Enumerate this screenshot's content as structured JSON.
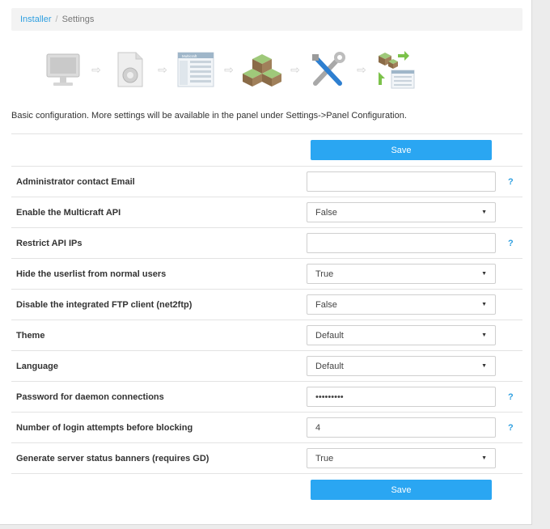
{
  "breadcrumb": {
    "root": "Installer",
    "separator": "/",
    "current": "Settings"
  },
  "steps": [
    {
      "icon": "monitor-icon"
    },
    {
      "icon": "document-gear-icon"
    },
    {
      "icon": "panel-screenshot-icon",
      "caption": "Multicraft"
    },
    {
      "icon": "blocks-icon"
    },
    {
      "icon": "tools-icon"
    },
    {
      "icon": "blocks-panel-icon"
    }
  ],
  "intro": "Basic configuration. More settings will be available in the panel under Settings->Panel Configuration.",
  "buttons": {
    "save": "Save"
  },
  "help_mark": "?",
  "colors": {
    "accent": "#2aa6f2",
    "link": "#2e9fe0"
  },
  "fields": [
    {
      "label": "Administrator contact Email",
      "type": "text",
      "value": "",
      "help": true
    },
    {
      "label": "Enable the Multicraft API",
      "type": "select",
      "value": "False",
      "help": false
    },
    {
      "label": "Restrict API IPs",
      "type": "text",
      "value": "",
      "help": true
    },
    {
      "label": "Hide the userlist from normal users",
      "type": "select",
      "value": "True",
      "help": false
    },
    {
      "label": "Disable the integrated FTP client (net2ftp)",
      "type": "select",
      "value": "False",
      "help": false
    },
    {
      "label": "Theme",
      "type": "select",
      "value": "Default",
      "help": false
    },
    {
      "label": "Language",
      "type": "select",
      "value": "Default",
      "help": false
    },
    {
      "label": "Password for daemon connections",
      "type": "password",
      "value": "•••••••••",
      "help": true
    },
    {
      "label": "Number of login attempts before blocking",
      "type": "text",
      "value": "4",
      "help": true
    },
    {
      "label": "Generate server status banners (requires GD)",
      "type": "select",
      "value": "True",
      "help": false
    }
  ]
}
